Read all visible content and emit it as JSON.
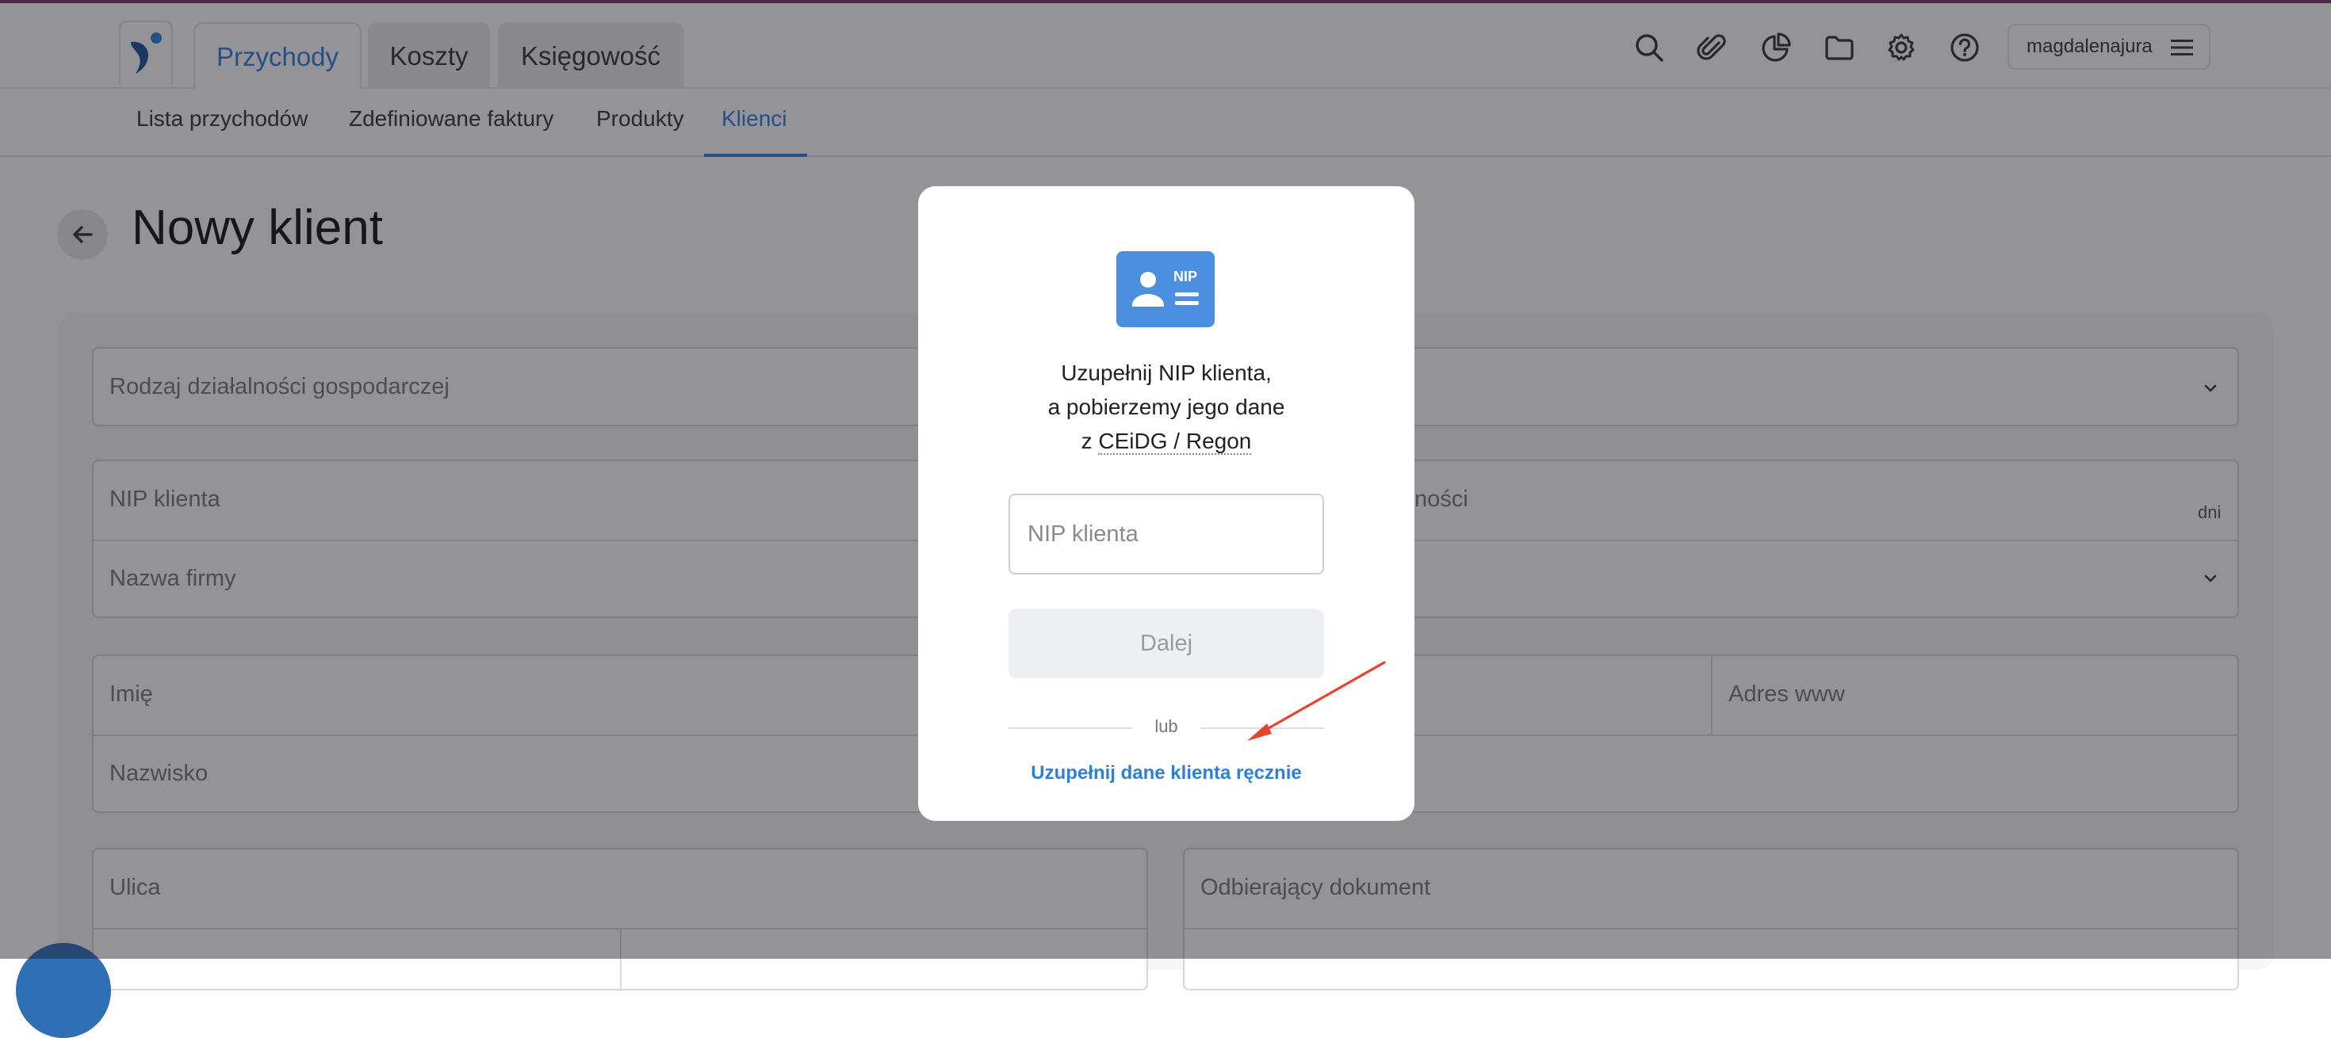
{
  "header": {
    "tabs": [
      {
        "label": "Przychody",
        "active": true
      },
      {
        "label": "Koszty",
        "active": false
      },
      {
        "label": "Księgowość",
        "active": false
      }
    ],
    "icons": [
      "search-icon",
      "paperclip-icon",
      "pie-chart-icon",
      "folder-icon",
      "gear-icon",
      "help-icon"
    ],
    "username": "magdalenajura"
  },
  "subnav": {
    "items": [
      {
        "label": "Lista przychodów",
        "active": false
      },
      {
        "label": "Zdefiniowane faktury",
        "active": false
      },
      {
        "label": "Produkty",
        "active": false
      },
      {
        "label": "Klienci",
        "active": true
      }
    ]
  },
  "page": {
    "title": "Nowy klient",
    "fields": {
      "business_type": "Rodzaj działalności gospodarczej",
      "nip": "NIP klienta",
      "company_name": "Nazwa firmy",
      "payment_term_partial": "ności",
      "days_unit": "dni",
      "first_name": "Imię",
      "website": "Adres www",
      "last_name": "Nazwisko",
      "street": "Ulica",
      "recipient": "Odbierający dokument"
    }
  },
  "modal": {
    "line1": "Uzupełnij NIP klienta,",
    "line2": "a pobierzemy jego dane",
    "line3_prefix": "z ",
    "line3_link": "CEiDG / Regon",
    "icon_label": "NIP",
    "input_placeholder": "NIP klienta",
    "next_button": "Dalej",
    "or_text": "lub",
    "manual_link": "Uzupełnij dane klienta ręcznie"
  },
  "colors": {
    "accent": "#2e7fd9",
    "annotation_arrow": "#e8432e",
    "nip_icon_bg": "#4a8fe0"
  }
}
